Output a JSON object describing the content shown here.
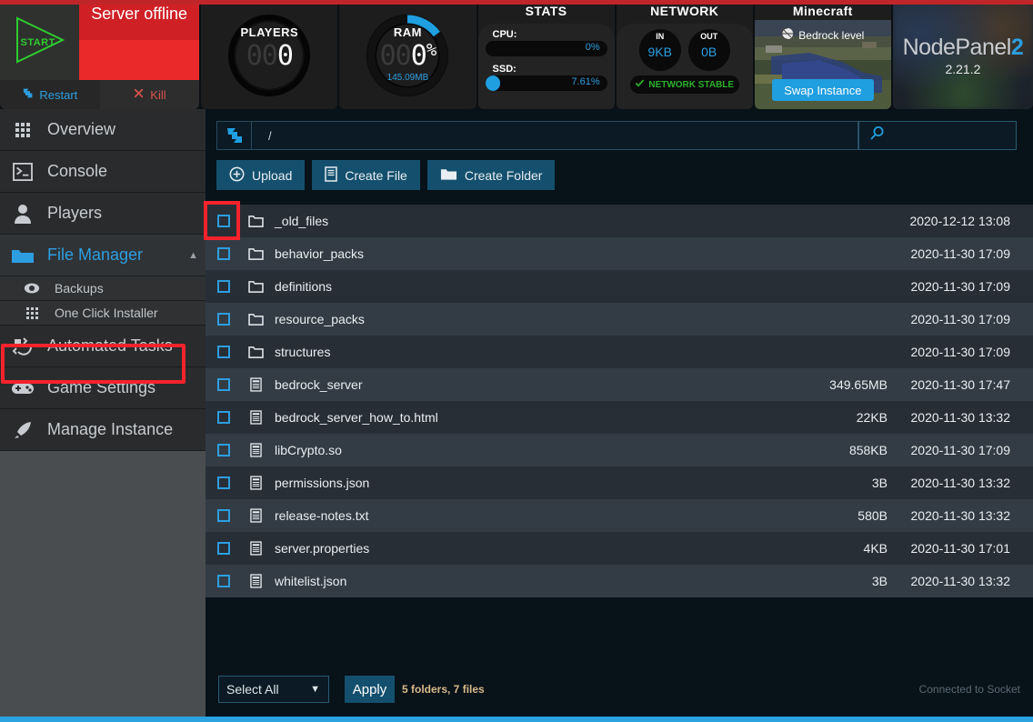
{
  "header": {
    "start_label": "START",
    "status": "Server offline",
    "restart": "Restart",
    "kill": "Kill",
    "players": {
      "title": "PLAYERS",
      "dim": "00",
      "value": "0"
    },
    "ram": {
      "title": "RAM",
      "dim": "00",
      "value": "0",
      "pct": "%",
      "sub": "145.09MB",
      "arc_pct": 17
    },
    "stats": {
      "title": "STATS",
      "rows": [
        {
          "name": "CPU:",
          "value": "0%",
          "fill": 0
        },
        {
          "name": "SSD:",
          "value": "7.61%",
          "fill": 12
        }
      ]
    },
    "network": {
      "title": "NETWORK",
      "in_label": "IN",
      "in_value": "9KB",
      "out_label": "OUT",
      "out_value": "0B",
      "status": "NETWORK STABLE"
    },
    "minecraft": {
      "title": "Minecraft",
      "level": "Bedrock level",
      "swap": "Swap Instance"
    },
    "nodepanel": {
      "name": "NodePanel",
      "suffix": "2",
      "version": "2.21.2"
    },
    "accent": "#2d9ee0",
    "danger": "#cf2026"
  },
  "sidebar": {
    "items": [
      {
        "label": "Overview",
        "icon": "grid-icon",
        "active": false
      },
      {
        "label": "Console",
        "icon": "terminal-icon",
        "active": false
      },
      {
        "label": "Players",
        "icon": "user-icon",
        "active": false
      },
      {
        "label": "File Manager",
        "icon": "folder-icon",
        "active": true
      },
      {
        "label": "Automated Tasks",
        "icon": "tasks-icon",
        "active": false
      },
      {
        "label": "Game Settings",
        "icon": "gamepad-icon",
        "active": false
      },
      {
        "label": "Manage Instance",
        "icon": "rocket-icon",
        "active": false
      }
    ],
    "subitems": [
      {
        "label": "Backups",
        "icon": "backup-icon"
      },
      {
        "label": "One Click Installer",
        "icon": "grid-icon"
      }
    ]
  },
  "main": {
    "path": "/",
    "search_placeholder": "",
    "search_value": "",
    "toolbar": [
      {
        "label": "Upload",
        "icon": "upload-icon"
      },
      {
        "label": "Create File",
        "icon": "file-icon"
      },
      {
        "label": "Create Folder",
        "icon": "folder-icon"
      }
    ],
    "files": [
      {
        "name": "_old_files",
        "type": "folder",
        "size": "",
        "date": "2020-12-12 13:08"
      },
      {
        "name": "behavior_packs",
        "type": "folder",
        "size": "",
        "date": "2020-11-30 17:09"
      },
      {
        "name": "definitions",
        "type": "folder",
        "size": "",
        "date": "2020-11-30 17:09"
      },
      {
        "name": "resource_packs",
        "type": "folder",
        "size": "",
        "date": "2020-11-30 17:09"
      },
      {
        "name": "structures",
        "type": "folder",
        "size": "",
        "date": "2020-11-30 17:09"
      },
      {
        "name": "bedrock_server",
        "type": "file",
        "size": "349.65MB",
        "date": "2020-11-30 17:47"
      },
      {
        "name": "bedrock_server_how_to.html",
        "type": "file",
        "size": "22KB",
        "date": "2020-11-30 13:32"
      },
      {
        "name": "libCrypto.so",
        "type": "file",
        "size": "858KB",
        "date": "2020-11-30 17:09"
      },
      {
        "name": "permissions.json",
        "type": "file",
        "size": "3B",
        "date": "2020-11-30 13:32"
      },
      {
        "name": "release-notes.txt",
        "type": "file",
        "size": "580B",
        "date": "2020-11-30 13:32"
      },
      {
        "name": "server.properties",
        "type": "file",
        "size": "4KB",
        "date": "2020-11-30 17:01"
      },
      {
        "name": "whitelist.json",
        "type": "file",
        "size": "3B",
        "date": "2020-11-30 13:32"
      }
    ],
    "bottom": {
      "select_value": "Select All",
      "select_options": [
        "Select All"
      ],
      "apply": "Apply",
      "counts": "5 folders, 7 files",
      "socket": "Connected to Socket"
    }
  }
}
